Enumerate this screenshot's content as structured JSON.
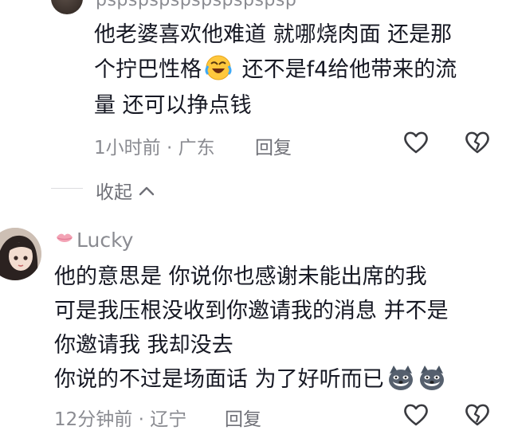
{
  "comment1": {
    "username": "pspspspspspspspspsp",
    "text_line1": "他老婆喜欢他难道 就哪烧肉面 还是那",
    "text_line2a": "个拧巴性格",
    "text_line2b": " 还不是f4给他带来的流",
    "text_line3": "量 还可以挣点钱",
    "time": "1小时前",
    "location": "广东",
    "reply_label": "回复",
    "collapse_label": "收起"
  },
  "comment2": {
    "username": "Lucky",
    "text_line1": "他的意思是   你说你也感谢未能出席的我",
    "text_line2": "可是我压根没收到你邀请我的消息   并不是",
    "text_line3": "你邀请我  我却没去",
    "text_line4": "你说的不过是场面话  为了好听而已",
    "time": "12分钟前",
    "location": "辽宁",
    "reply_label": "回复"
  },
  "separator": "·",
  "colors": {
    "text": "#161823",
    "meta": "#8a8b91",
    "lips": "#f3a3b5"
  },
  "icons": [
    "heart-icon",
    "broken-heart-icon",
    "chevron-up-icon",
    "lips-icon",
    "laughing-crying-emoji",
    "dog-emoji"
  ]
}
